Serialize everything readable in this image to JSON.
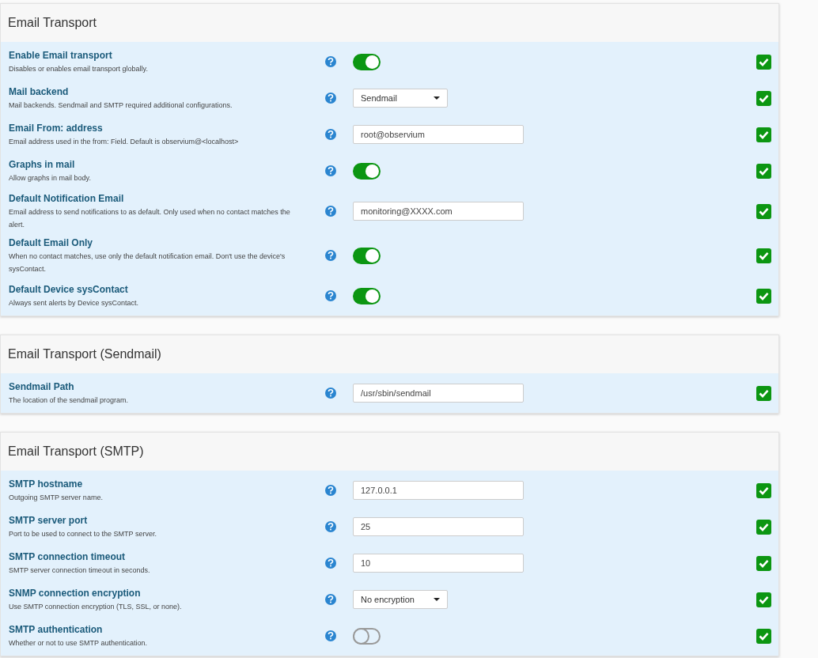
{
  "sections": [
    {
      "title": "Email Transport",
      "settings": [
        {
          "kind": "toggle",
          "label": "Enable Email transport",
          "description": "Disables or enables email transport globally.",
          "on": true,
          "checked": true
        },
        {
          "kind": "select",
          "label": "Mail backend",
          "description": "Mail backends. Sendmail and SMTP required additional configurations.",
          "value": "Sendmail",
          "checked": true
        },
        {
          "kind": "text",
          "label": "Email From: address",
          "description": "Email address used in the from: Field. Default is observium@<localhost>",
          "value": "root@observium",
          "checked": true
        },
        {
          "kind": "toggle",
          "label": "Graphs in mail",
          "description": "Allow graphs in mail body.",
          "on": true,
          "checked": true
        },
        {
          "kind": "text",
          "label": "Default Notification Email",
          "description": "Email address to send notifications to as default. Only used when no contact matches the alert.",
          "value": "monitoring@XXXX.com",
          "checked": true
        },
        {
          "kind": "toggle",
          "label": "Default Email Only",
          "description": "When no contact matches, use only the default notification email. Don't use the device's sysContact.",
          "on": true,
          "checked": true
        },
        {
          "kind": "toggle",
          "label": "Default Device sysContact",
          "description": "Always sent alerts by Device sysContact.",
          "on": true,
          "checked": true
        }
      ]
    },
    {
      "title": "Email Transport (Sendmail)",
      "settings": [
        {
          "kind": "text",
          "label": "Sendmail Path",
          "description": "The location of the sendmail program.",
          "value": "/usr/sbin/sendmail",
          "checked": true
        }
      ]
    },
    {
      "title": "Email Transport (SMTP)",
      "settings": [
        {
          "kind": "text",
          "label": "SMTP hostname",
          "description": "Outgoing SMTP server name.",
          "value": "127.0.0.1",
          "checked": true
        },
        {
          "kind": "text",
          "label": "SMTP server port",
          "description": "Port to be used to connect to the SMTP server.",
          "value": "25",
          "checked": true
        },
        {
          "kind": "text",
          "label": "SMTP connection timeout",
          "description": "SMTP server connection timeout in seconds.",
          "value": "10",
          "checked": true
        },
        {
          "kind": "select",
          "label": "SNMP connection encryption",
          "description": "Use SMTP connection encryption (TLS, SSL, or none).",
          "value": "No encryption",
          "checked": true
        },
        {
          "kind": "toggle",
          "label": "SMTP authentication",
          "description": "Whether or not to use SMTP authentication.",
          "on": false,
          "checked": true
        }
      ]
    }
  ]
}
